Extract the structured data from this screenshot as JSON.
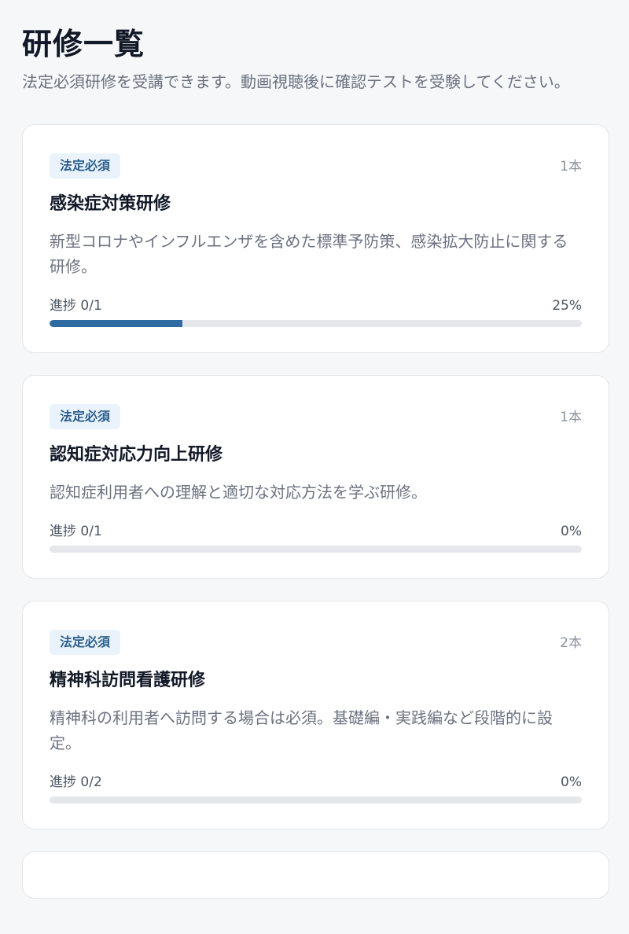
{
  "header": {
    "title": "研修一覧",
    "description": "法定必須研修を受講できます。動画視聴後に確認テストを受験してください。"
  },
  "courses": [
    {
      "badge": "法定必須",
      "count": "1本",
      "title": "感染症対策研修",
      "description": "新型コロナやインフルエンザを含めた標準予防策、感染拡大防止に関する研修。",
      "progress_label": "進捗 0/1",
      "progress_percent_label": "25%",
      "progress_value": 25
    },
    {
      "badge": "法定必須",
      "count": "1本",
      "title": "認知症対応力向上研修",
      "description": "認知症利用者への理解と適切な対応方法を学ぶ研修。",
      "progress_label": "進捗 0/1",
      "progress_percent_label": "0%",
      "progress_value": 0
    },
    {
      "badge": "法定必須",
      "count": "2本",
      "title": "精神科訪問看護研修",
      "description": "精神科の利用者へ訪問する場合は必須。基礎編・実践編など段階的に設定。",
      "progress_label": "進捗 0/2",
      "progress_percent_label": "0%",
      "progress_value": 0
    }
  ],
  "colors": {
    "accent": "#2f6aa3",
    "badge_bg": "#eaf3fb",
    "badge_text": "#2c5f8e"
  }
}
